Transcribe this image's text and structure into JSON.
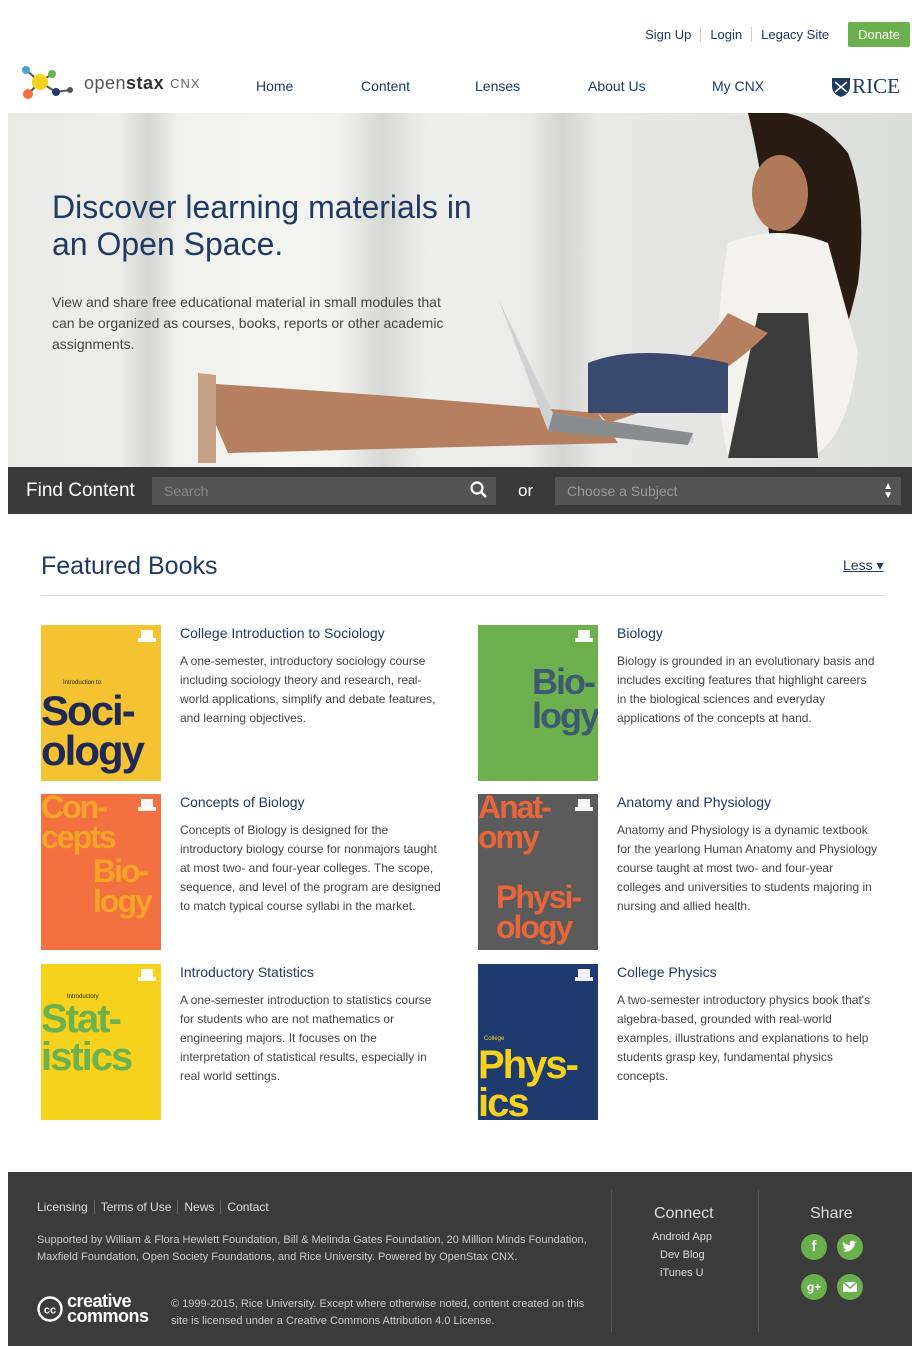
{
  "header": {
    "top_links": [
      "Sign Up",
      "Login",
      "Legacy Site"
    ],
    "donate": "Donate",
    "brand_open": "open",
    "brand_stax": "stax",
    "brand_cnx": "CNX",
    "nav": [
      "Home",
      "Content",
      "Lenses",
      "About Us",
      "My CNX"
    ],
    "rice": "RICE"
  },
  "hero": {
    "headline": "Discover learning materials in an Open Space.",
    "body": "View and share free educational material in small modules that can be organized as courses, books, reports or other academic assignments."
  },
  "search": {
    "label": "Find Content",
    "placeholder": "Search",
    "or": "or",
    "subject": "Choose a Subject"
  },
  "featured": {
    "title": "Featured Books",
    "less": "Less ▾",
    "books": [
      {
        "title": "College Introduction to Sociology",
        "desc": "A one-semester, introductory sociology course including sociology theory and research, real-world applications, simplify and debate features, and learning objectives.",
        "cover_color": "#f5c331",
        "cover_lines": [
          "Soci-",
          "ology"
        ],
        "cover_small": "Introduction to"
      },
      {
        "title": "Biology",
        "desc": "Biology is grounded in an evolutionary basis and includes exciting features that highlight careers in the biological sciences and everyday applications of the concepts at hand.",
        "cover_color": "#6db14e",
        "cover_lines": [
          "Bio-",
          "logy"
        ],
        "cover_small": ""
      },
      {
        "title": "Concepts of Biology",
        "desc": "Concepts of Biology is designed for the introductory biology course for nonmajors taught at most two- and four-year colleges. The scope, sequence, and level of the program are designed to match typical course syllabi in the market.",
        "cover_color": "#f37140",
        "cover_lines": [
          "Con-",
          "cepts",
          "Bio-",
          "logy"
        ],
        "cover_small": ""
      },
      {
        "title": "Anatomy and Physiology",
        "desc": "Anatomy and Physiology is a dynamic textbook for the yearlong Human Anatomy and Physiology course taught at most two- and four-year colleges and universities to students majoring in nursing and allied health.",
        "cover_color": "#5b5b5b",
        "cover_lines": [
          "Anat-",
          "omy",
          "Physi-",
          "ology"
        ],
        "cover_small": ""
      },
      {
        "title": "Introductory Statistics",
        "desc": "A one-semester introduction to statistics course for students who are not mathematics or engineering majors. It focuses on the interpretation of statistical results, especially in real world settings.",
        "cover_color": "#f6d21c",
        "cover_lines": [
          "Stat-",
          "istics"
        ],
        "cover_small": "Introductory"
      },
      {
        "title": "College Physics",
        "desc": "A two-semester introductory physics book that's algebra-based, grounded with real-world examples, illustrations and explanations to help students grasp key, fundamental physics concepts.",
        "cover_color": "#1e3a6e",
        "cover_lines": [
          "Phys-",
          "ics"
        ],
        "cover_small": "College"
      }
    ]
  },
  "footer": {
    "links": [
      "Licensing",
      "Terms of Use",
      "News",
      "Contact"
    ],
    "support": "Supported by William & Flora Hewlett Foundation, Bill & Melinda Gates Foundation, 20 Million Minds Foundation, Maxfield Foundation, Open Society Foundations, and Rice University. Powered by OpenStax CNX.",
    "cc_line1": "creative",
    "cc_line2": "commons",
    "copyright": "© 1999-2015, Rice University. Except where otherwise noted, content created on this site is licensed under a Creative Commons Attribution 4.0 License.",
    "connect_title": "Connect",
    "connect_links": [
      "Android App",
      "Dev Blog",
      "iTunes U"
    ],
    "share_title": "Share",
    "share_icons": [
      "facebook-icon",
      "twitter-icon",
      "google-plus-icon",
      "email-icon"
    ]
  }
}
